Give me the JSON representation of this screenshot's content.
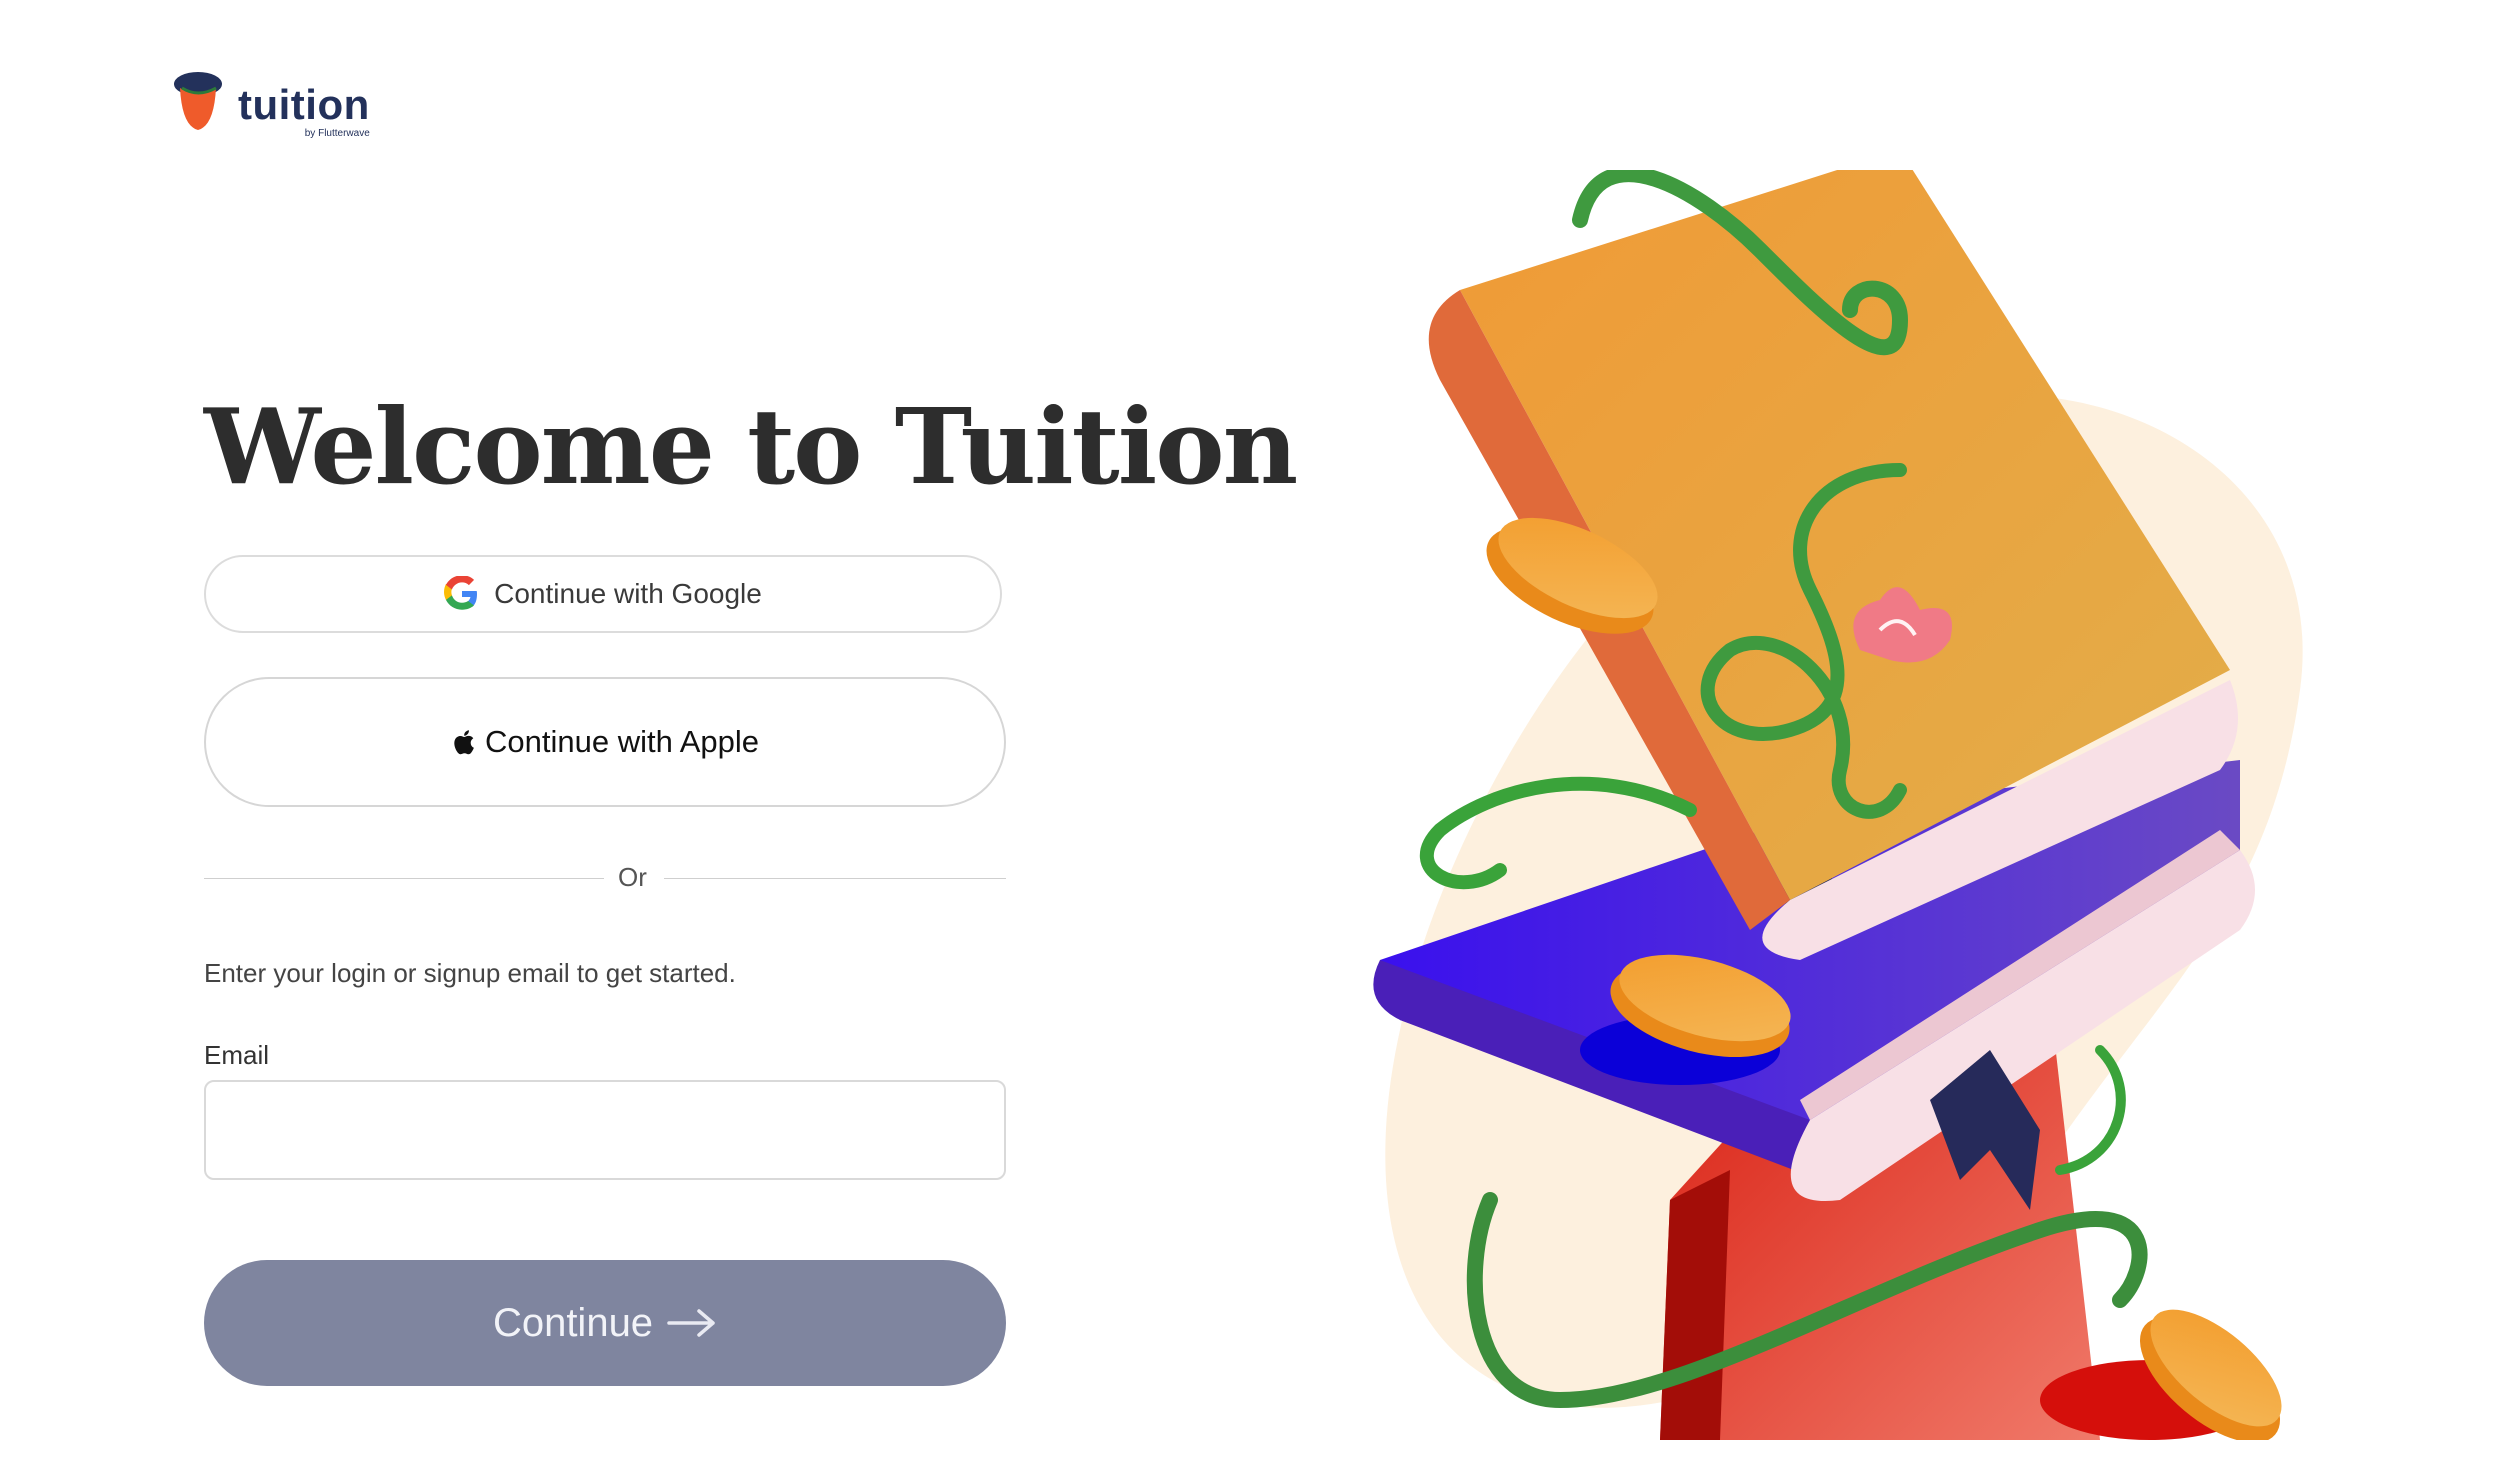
{
  "brand": {
    "name": "tuition",
    "tagline": "by Flutterwave",
    "colors": {
      "navy": "#23315b",
      "orange": "#ef5b2b",
      "cta_disabled": "#7f859f"
    }
  },
  "main": {
    "title": "Welcome to Tuition",
    "google_button": {
      "label": "Continue with Google",
      "icon": "google-icon"
    },
    "apple_button": {
      "label": "Continue with Apple",
      "icon": "apple-icon"
    },
    "divider_text": "Or",
    "instructions": "Enter your login or signup email to get started.",
    "email": {
      "label": "Email",
      "value": "",
      "placeholder": ""
    },
    "continue_button": {
      "label": "Continue",
      "icon": "arrow-right-icon",
      "state": "disabled"
    }
  },
  "illustration": {
    "subject": "stack-of-books-with-coins-and-vines"
  }
}
